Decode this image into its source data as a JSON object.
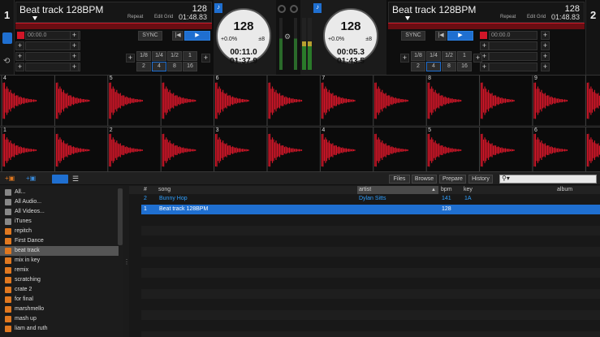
{
  "decks": [
    {
      "number": "1",
      "title": "Beat track 128BPM",
      "bpm": "128",
      "repeat": "Repeat",
      "edit_grid": "Edit Grid",
      "time_remaining": "01:48.83",
      "cue_time": "00:00.0",
      "sync": "SYNC",
      "loops": [
        "1/8",
        "1/4",
        "1/2",
        "1",
        "2",
        "4",
        "8",
        "16"
      ],
      "platter": {
        "bpm": "128",
        "pitch": "+0.0%",
        "range": "±8",
        "elapsed": "00:11.0",
        "remaining": "01:37.9"
      }
    },
    {
      "number": "2",
      "title": "Beat track 128BPM",
      "bpm": "128",
      "repeat": "Repeat",
      "edit_grid": "Edit Grid",
      "time_remaining": "01:48.83",
      "cue_time": "00:00.0",
      "sync": "SYNC",
      "loops": [
        "1/8",
        "1/4",
        "1/2",
        "1",
        "2",
        "4",
        "8",
        "16"
      ],
      "platter": {
        "bpm": "128",
        "pitch": "+0.0%",
        "range": "±8",
        "elapsed": "00:05.3",
        "remaining": "01:43.5"
      }
    }
  ],
  "waveform_top_beats": [
    "4",
    "5",
    "6",
    "7",
    "8",
    "9"
  ],
  "waveform_bottom_beats": [
    "1",
    "2",
    "3",
    "4",
    "5",
    "6"
  ],
  "library": {
    "tabs": [
      "Files",
      "Browse",
      "Prepare",
      "History"
    ],
    "search_icon": "search-icon",
    "sidebar": [
      "All...",
      "All Audio...",
      "All Videos...",
      "iTunes",
      "repitch",
      "First Dance",
      "beat track",
      "mix in key",
      "remix",
      "scratching",
      "crate 2",
      "for final",
      "marshmello",
      "mash up",
      "liam and ruth"
    ],
    "selected_crate": "beat track",
    "columns": [
      "#",
      "song",
      "artist",
      "bpm",
      "key",
      "album"
    ],
    "rows": [
      {
        "num": "2",
        "song": "Bunny Hop",
        "artist": "Dylan Sitts",
        "bpm": "141",
        "key": "1A",
        "album": ""
      },
      {
        "num": "1",
        "song": "Beat track 128BPM",
        "artist": "",
        "bpm": "128",
        "key": "",
        "album": ""
      }
    ]
  },
  "colors": {
    "accent_blue": "#1f6fd0",
    "waveform_red": "#d01628",
    "crate_orange": "#e07820"
  }
}
